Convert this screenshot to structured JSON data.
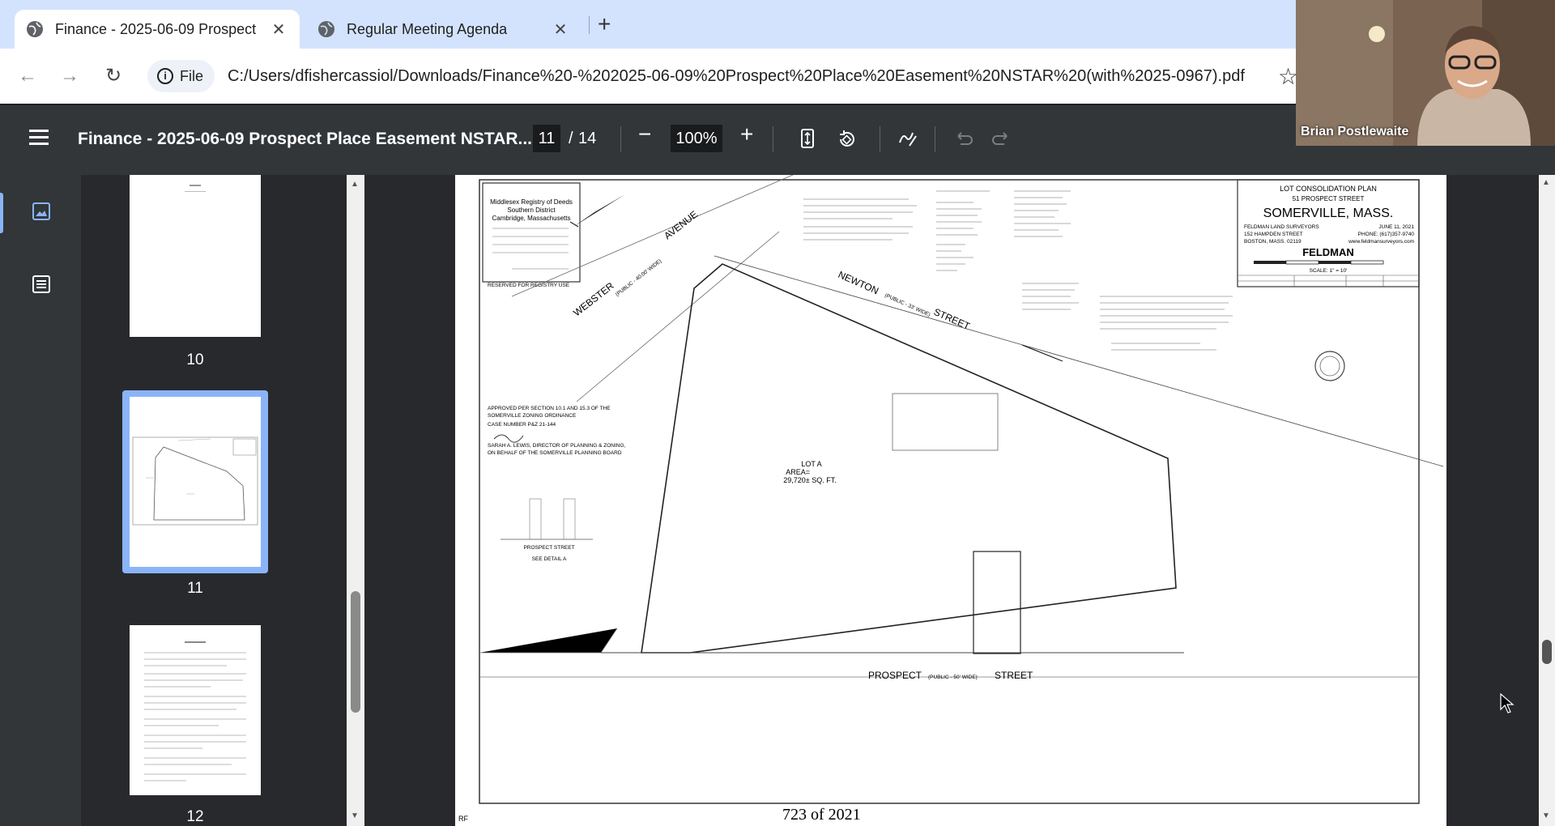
{
  "browser": {
    "tabs": [
      {
        "title": "Finance - 2025-06-09 Prospect",
        "active": true
      },
      {
        "title": "Regular Meeting Agenda",
        "active": false
      }
    ],
    "address": {
      "chip_label": "File",
      "url": "C:/Users/dfishercassiol/Downloads/Finance%20-%202025-06-09%20Prospect%20Place%20Easement%20NSTAR%20(with%2025-0967).pdf"
    }
  },
  "pdf_toolbar": {
    "title": "Finance - 2025-06-09 Prospect Place Easement NSTAR...",
    "current_page": "11",
    "separator": "/",
    "total_pages": "14",
    "zoom": "100%"
  },
  "thumbnails": [
    {
      "label": "10"
    },
    {
      "label": "11",
      "selected": true
    },
    {
      "label": "12"
    }
  ],
  "webcam": {
    "name": "Brian Postlewaite"
  },
  "plan": {
    "title_block": {
      "heading": "LOT CONSOLIDATION PLAN",
      "address": "51 PROSPECT STREET",
      "city": "SOMERVILLE, MASS.",
      "firm_line1": "FELDMAN LAND SURVEYORS",
      "firm_line2": "152 HAMPDEN STREET",
      "firm_line3": "BOSTON, MASS. 02119",
      "date": "JUNE 11, 2021",
      "phone": "PHONE: (617)357-9740",
      "web": "www.feldmansurveyors.com",
      "logo": "FELDMAN",
      "scale": "SCALE: 1\" = 10'"
    },
    "registry": {
      "line1": "Middlesex Registry of Deeds",
      "line2": "Southern District",
      "line3": "Cambridge, Massachusetts"
    },
    "reserved": "RESERVED FOR REGISTRY USE",
    "streets": {
      "webster": "WEBSTER",
      "webster_public": "(PUBLIC - 40.00' WIDE)",
      "avenue": "AVENUE",
      "newton": "NEWTON",
      "newton_public": "(PUBLIC - 33' WIDE)",
      "newton_street": "STREET",
      "prospect": "PROSPECT",
      "prospect_public": "(PUBLIC - 50' WIDE)",
      "prospect_street": "STREET"
    },
    "lot": {
      "name": "LOT A",
      "area_label": "AREA=",
      "area": "29,720± SQ. FT."
    },
    "approval": {
      "line1": "APPROVED PER SECTION 10.1 AND 15.3 OF THE",
      "line2": "SOMERVILLE ZONING ORDINANCE",
      "line3": "CASE NUMBER P&Z 21-144",
      "line4": "SARAH A. LEWIS, DIRECTOR OF PLANNING & ZONING,",
      "line5": "ON BEHALF OF THE SOMERVILLE PLANNING BOARD"
    },
    "detail": {
      "street": "PROSPECT STREET",
      "label": "SEE DETAIL A"
    },
    "handwritten": "723 of 2021",
    "initials": "RF"
  }
}
